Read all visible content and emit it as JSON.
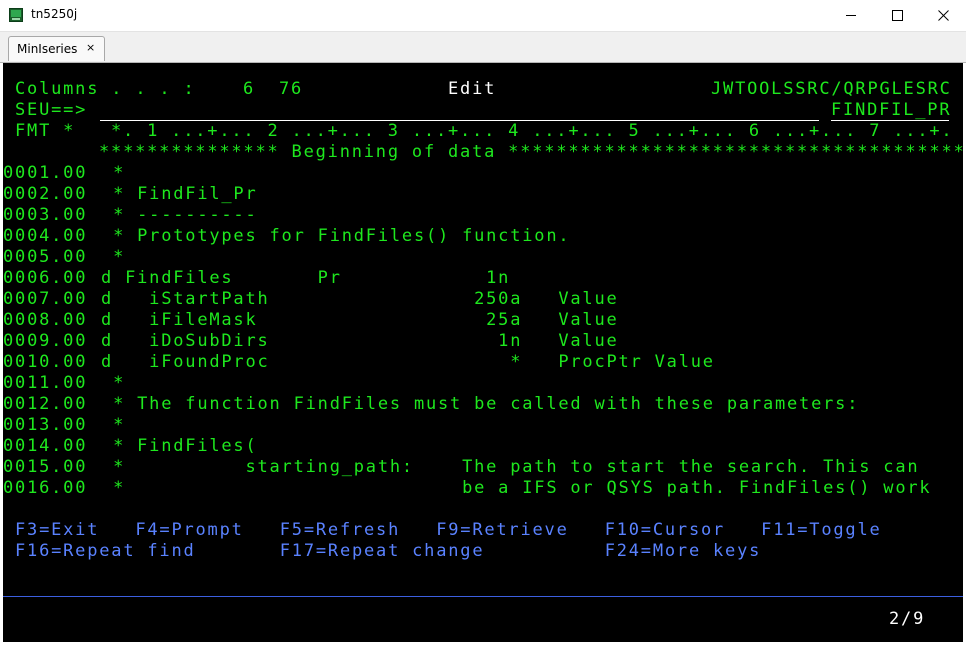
{
  "window": {
    "title": "tn5250j",
    "icon": "tn5250j-app-icon",
    "controls": [
      "minimize",
      "maximize",
      "close"
    ]
  },
  "tab": {
    "label": "MinIseries",
    "close_glyph": "×"
  },
  "terminal": {
    "header": {
      "columns_label": "Columns . . . :",
      "columns_start": "6",
      "columns_end": "76",
      "mode": "Edit",
      "source_path": "JWTOOLSSRC/QRPGLESRC",
      "seu_prompt": "SEU==>",
      "member": "FINDFIL_PR",
      "fmt_label": "FMT *",
      "ruler": "*. 1 ...+... 2 ...+... 3 ...+... 4 ...+... 5 ...+... 6 ...+... 7 ...+.",
      "beginning": "*************** Beginning of data ***************************************"
    },
    "lines": [
      {
        "seq": "0001.00",
        "text": "  *"
      },
      {
        "seq": "0002.00",
        "text": "  * FindFil_Pr"
      },
      {
        "seq": "0003.00",
        "text": "  * ----------"
      },
      {
        "seq": "0004.00",
        "text": "  * Prototypes for FindFiles() function."
      },
      {
        "seq": "0005.00",
        "text": "  *"
      },
      {
        "seq": "0006.00",
        "text": " d FindFiles       Pr            1n"
      },
      {
        "seq": "0007.00",
        "text": " d   iStartPath                 250a   Value"
      },
      {
        "seq": "0008.00",
        "text": " d   iFileMask                   25a   Value"
      },
      {
        "seq": "0009.00",
        "text": " d   iDoSubDirs                   1n   Value"
      },
      {
        "seq": "0010.00",
        "text": " d   iFoundProc                    *   ProcPtr Value"
      },
      {
        "seq": "0011.00",
        "text": "  *"
      },
      {
        "seq": "0012.00",
        "text": "  * The function FindFiles must be called with these parameters:"
      },
      {
        "seq": "0013.00",
        "text": "  *"
      },
      {
        "seq": "0014.00",
        "text": "  * FindFiles("
      },
      {
        "seq": "0015.00",
        "text": "  *          starting_path:    The path to start the search. This can"
      },
      {
        "seq": "0016.00",
        "text": "  *                            be a IFS or QSYS path. FindFiles() work"
      }
    ],
    "function_keys_row1": "F3=Exit   F4=Prompt   F5=Refresh   F9=Retrieve   F10=Cursor   F11=Toggle",
    "function_keys_row2": "F16=Repeat find       F17=Repeat change          F24=More keys",
    "status_page": "2/9",
    "colors": {
      "background": "#000000",
      "text_green": "#1ee81e",
      "text_white": "#ffffff",
      "text_blue": "#5a82ff"
    }
  }
}
